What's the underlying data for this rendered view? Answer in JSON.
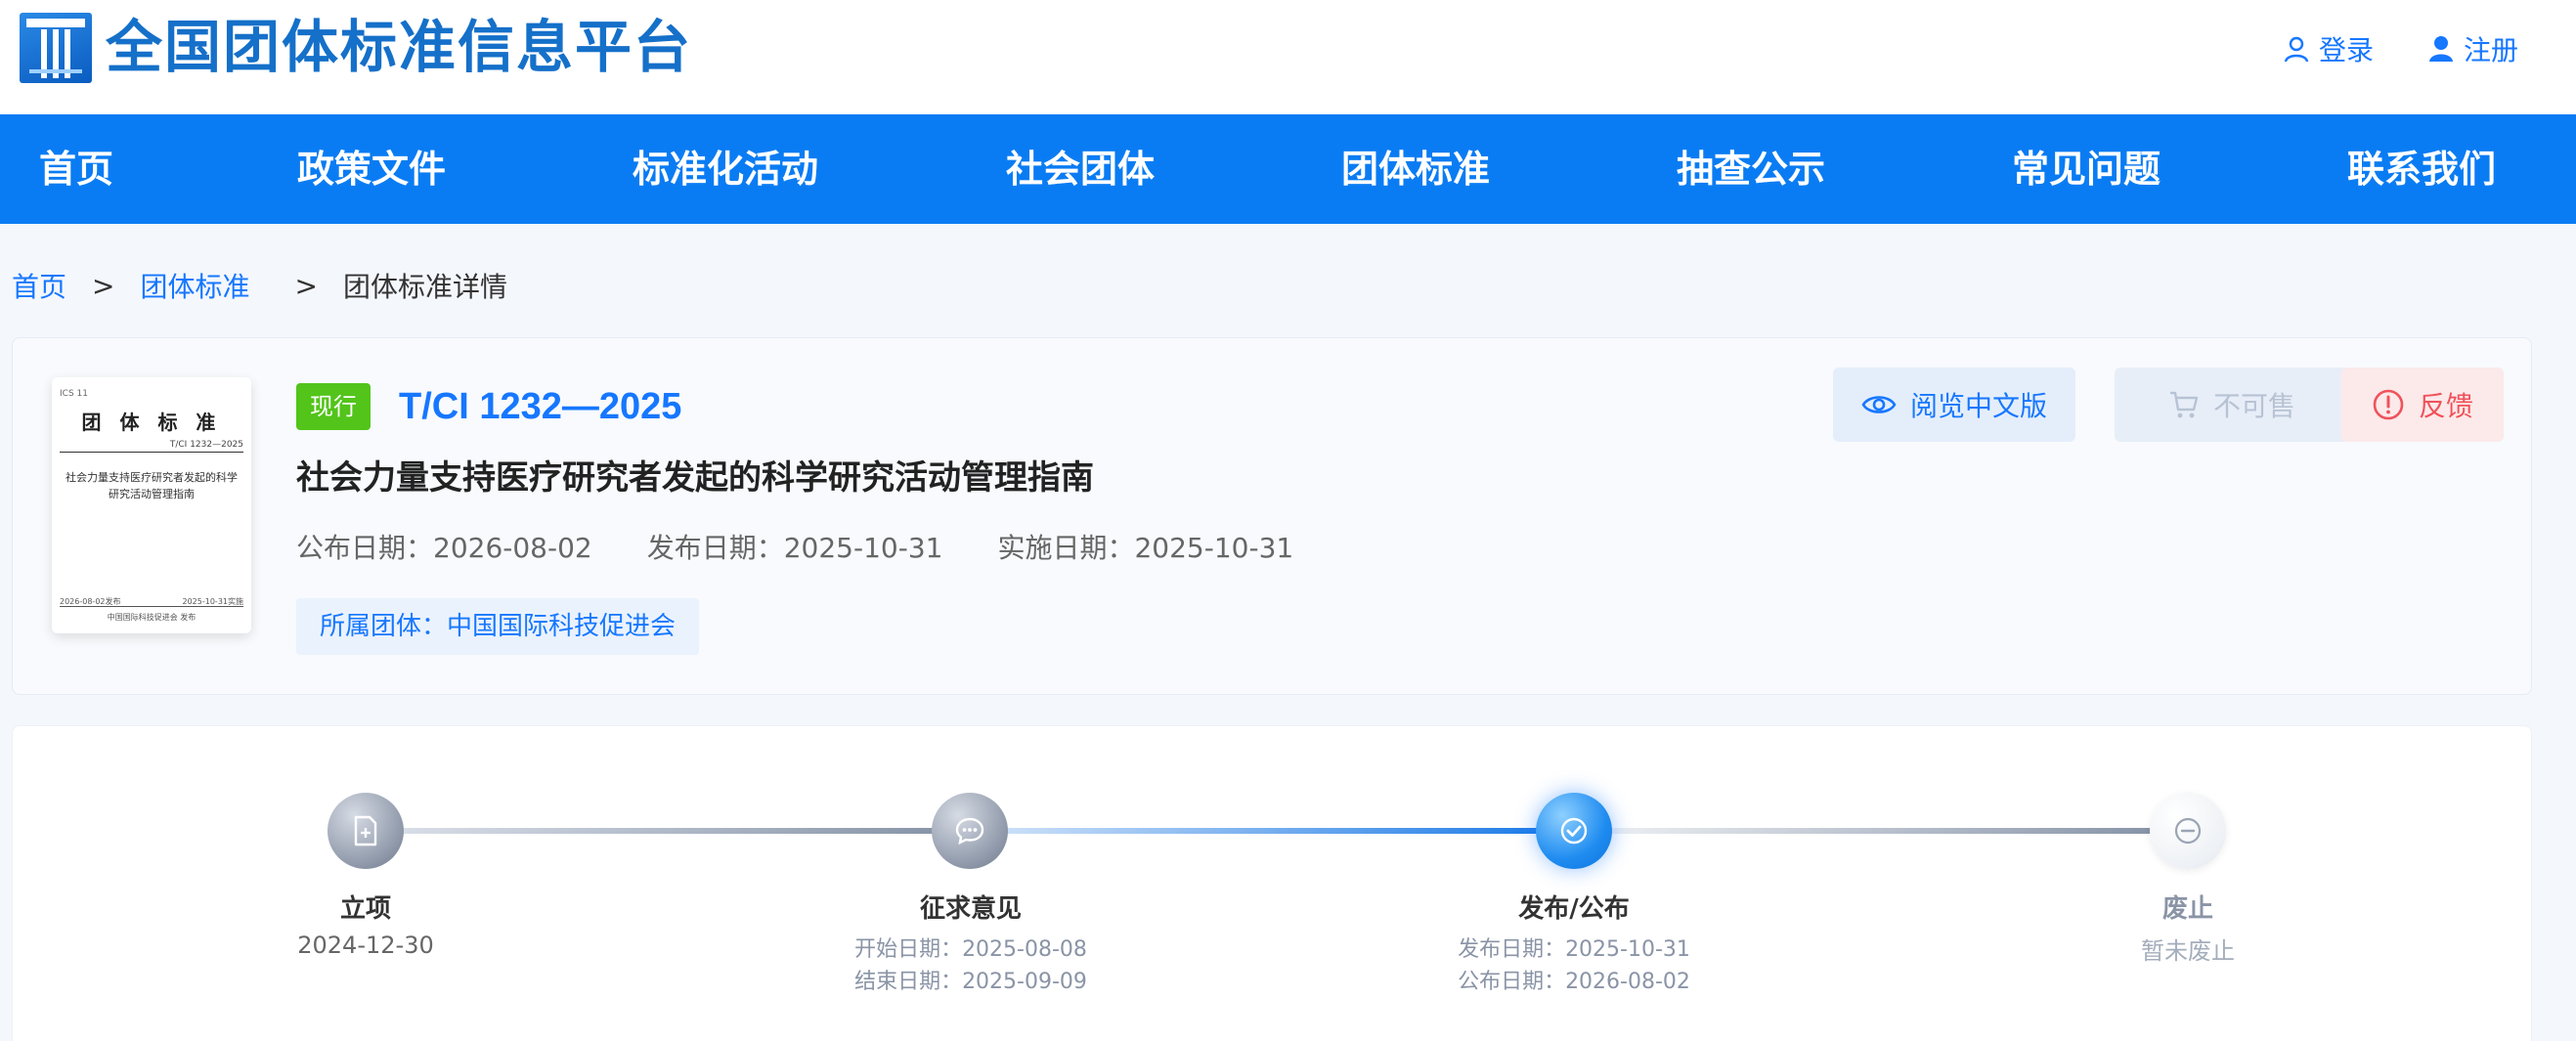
{
  "header": {
    "site_title": "全国团体标准信息平台",
    "login_label": "登录",
    "register_label": "注册"
  },
  "nav": {
    "items": [
      {
        "label": "首页"
      },
      {
        "label": "政策文件"
      },
      {
        "label": "标准化活动"
      },
      {
        "label": "社会团体"
      },
      {
        "label": "团体标准"
      },
      {
        "label": "抽查公示"
      },
      {
        "label": "常见问题"
      },
      {
        "label": "联系我们"
      }
    ]
  },
  "breadcrumb": {
    "home": "首页",
    "sep": ">",
    "section": "团体标准",
    "current": "团体标准详情"
  },
  "standard": {
    "status": "现行",
    "code": "T/CI 1232—2025",
    "name": "社会力量支持医疗研究者发起的科学研究活动管理指南",
    "announce_date": "公布日期：2026-08-02",
    "publish_date": "发布日期：2025-10-31",
    "implement_date": "实施日期：2025-10-31",
    "organization": "所属团体：中国国际科技促进会",
    "cover": {
      "ics": "ICS 11",
      "title": "团 体 标 准",
      "code": "T/CI 1232—2025",
      "name": "社会力量支持医疗研究者发起的科学研究活动管理指南",
      "publish": "2026-08-02发布",
      "implement": "2025-10-31实施",
      "org": "中国国际科技促进会 发布"
    }
  },
  "actions": {
    "read_label": "阅览中文版",
    "buy_label": "不可售",
    "feedback_label": "反馈"
  },
  "progress": {
    "steps": [
      {
        "label": "立项",
        "lines": [
          "2024-12-30"
        ]
      },
      {
        "label": "征求意见",
        "lines": [
          "开始日期：2025-08-08",
          "结束日期：2025-09-09"
        ]
      },
      {
        "label": "发布/公布",
        "lines": [
          "发布日期：2025-10-31",
          "公布日期：2026-08-02"
        ]
      },
      {
        "label": "废止",
        "lines": [
          "暂未废止"
        ]
      }
    ]
  },
  "colors": {
    "primary": "#1677ff",
    "nav_bg": "#0a7cf3",
    "status_green": "#52c41a",
    "feedback_red": "#f0525a"
  },
  "icons": [
    "logo-mark",
    "user-outline-icon",
    "user-solid-icon",
    "eye-icon",
    "cart-icon",
    "alert-circle-icon",
    "document-plus-icon",
    "chat-bubble-icon",
    "check-icon",
    "minus-circle-icon"
  ]
}
